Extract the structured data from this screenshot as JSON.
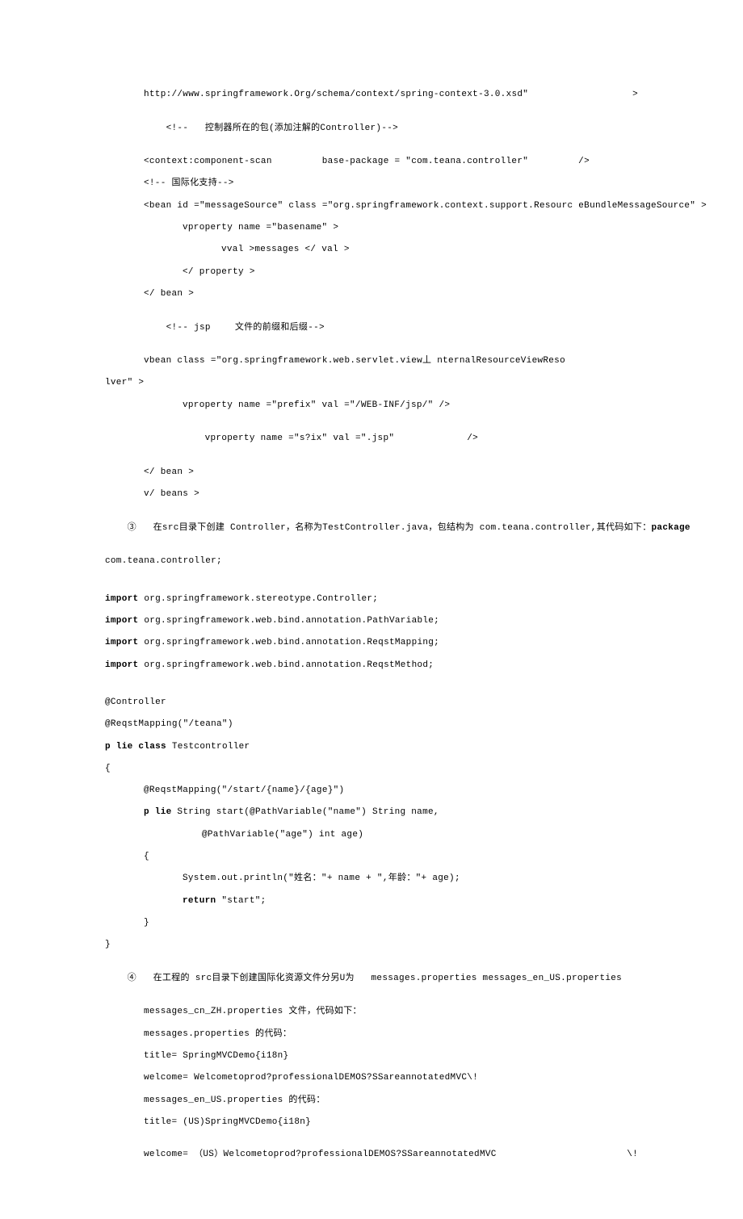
{
  "lines": {
    "l1": "http://www.springframework.Org/schema/context/spring-context-3.0.xsd\"",
    "l1r": ">",
    "l2a": "<!--   控制器所在的包(添加注解的",
    "l2b": "Controller)-->",
    "l3a": "<context:component-scan",
    "l3b": "base-package = \"com.teana.controller\"",
    "l3c": "/>",
    "l4": "<!-- 国际化支持-->",
    "l5": "<bean id =\"messageSource\" class =\"org.springframework.context.support.Resourc eBundleMessageSource\" >",
    "l6": "vproperty name =\"basename\" >",
    "l7": "vval >messages </ val >",
    "l8": "</ property >",
    "l9": "</ bean >",
    "l10a": "<!-- jsp",
    "l10b": "文件的前缀和后缀-->",
    "l11": "vbean class =\"org.springframework.web.servlet.view丄 nternalResourceViewReso",
    "l12": "lver\" >",
    "l13": "vproperty name =\"prefix\" val =\"/WEB-INF/jsp/\" />",
    "l14a": "vproperty name =\"s?ix\" val =\".jsp\"",
    "l14b": "/>",
    "l15": "</ bean >",
    "l16": "v/ beans >",
    "l17a": "③   在",
    "l17b": "src",
    "l17c": "目录下创建 Controller，名称为",
    "l17d": "TestController.java",
    "l17e": "，包结构为 com.teana.controller,其代码如下：",
    "l17f": "package",
    "l18": "com.teana.controller;",
    "l19a": "import",
    "l19b": " org.springframework.stereotype.Controller;",
    "l20a": "import",
    "l20b": " org.springframework.web.bind.annotation.PathVariable;",
    "l21a": "import",
    "l21b": " org.springframework.web.bind.annotation.ReqstMapping;",
    "l22a": "import",
    "l22b": " org.springframework.web.bind.annotation.ReqstMethod;",
    "l23": "@Controller",
    "l24": "@ReqstMapping(\"/teana\")",
    "l25a": "p lie class ",
    "l25b": "Testcontroller",
    "l26": "{",
    "l27": "@ReqstMapping(\"/start/{name}/{age}\")",
    "l28a": "p lie ",
    "l28b": "String start(@PathVariable(\"name\") String name,",
    "l29": "@PathVariable(\"age\") int age)",
    "l30": "{",
    "l31": "System.out.println(\"姓名：\"+ name + \",年龄：\"+ age);",
    "l32a": "return ",
    "l32b": "\"start\";",
    "l33": "}",
    "l34": "}",
    "l35a": "④   在工程的 src目录下创建国际化资源文件分另U为",
    "l35b": "   messages.properties messages_en_US.properties",
    "l36": "messages_cn_ZH.properties 文件，代码如下：",
    "l37": "messages.properties 的代码：",
    "l38": "title= SpringMVCDemo{i18n}",
    "l39": "welcome= Welcometoprod?professionalDEMOS?SSareannotatedMVC\\!",
    "l40": "messages_en_US.properties 的代码：",
    "l41": "title= (US)SpringMVCDemo{i18n}",
    "l42a": "welcome= （US）Welcometoprod?professionalDEMOS?SSareannotatedMVC",
    "l42b": "\\!"
  }
}
